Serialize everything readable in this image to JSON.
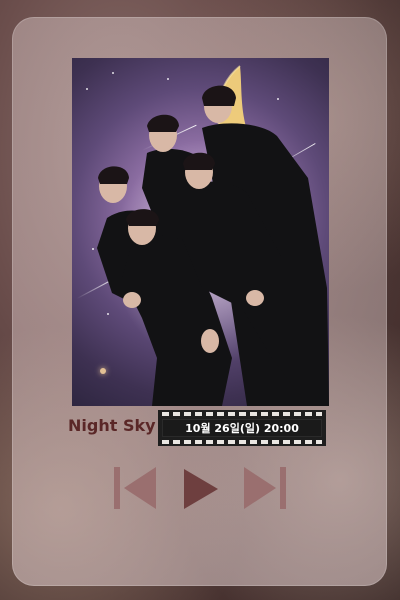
{
  "player": {
    "song_title": "Night Sky",
    "date_text": "10월 26일(일) 20:00",
    "controls": {
      "previous_icon": "skip-previous-icon",
      "play_icon": "play-icon",
      "next_icon": "skip-next-icon",
      "color": "#9a6f6f"
    }
  },
  "colors": {
    "title": "#5a2727",
    "film_strip": "#1e1e1e"
  }
}
